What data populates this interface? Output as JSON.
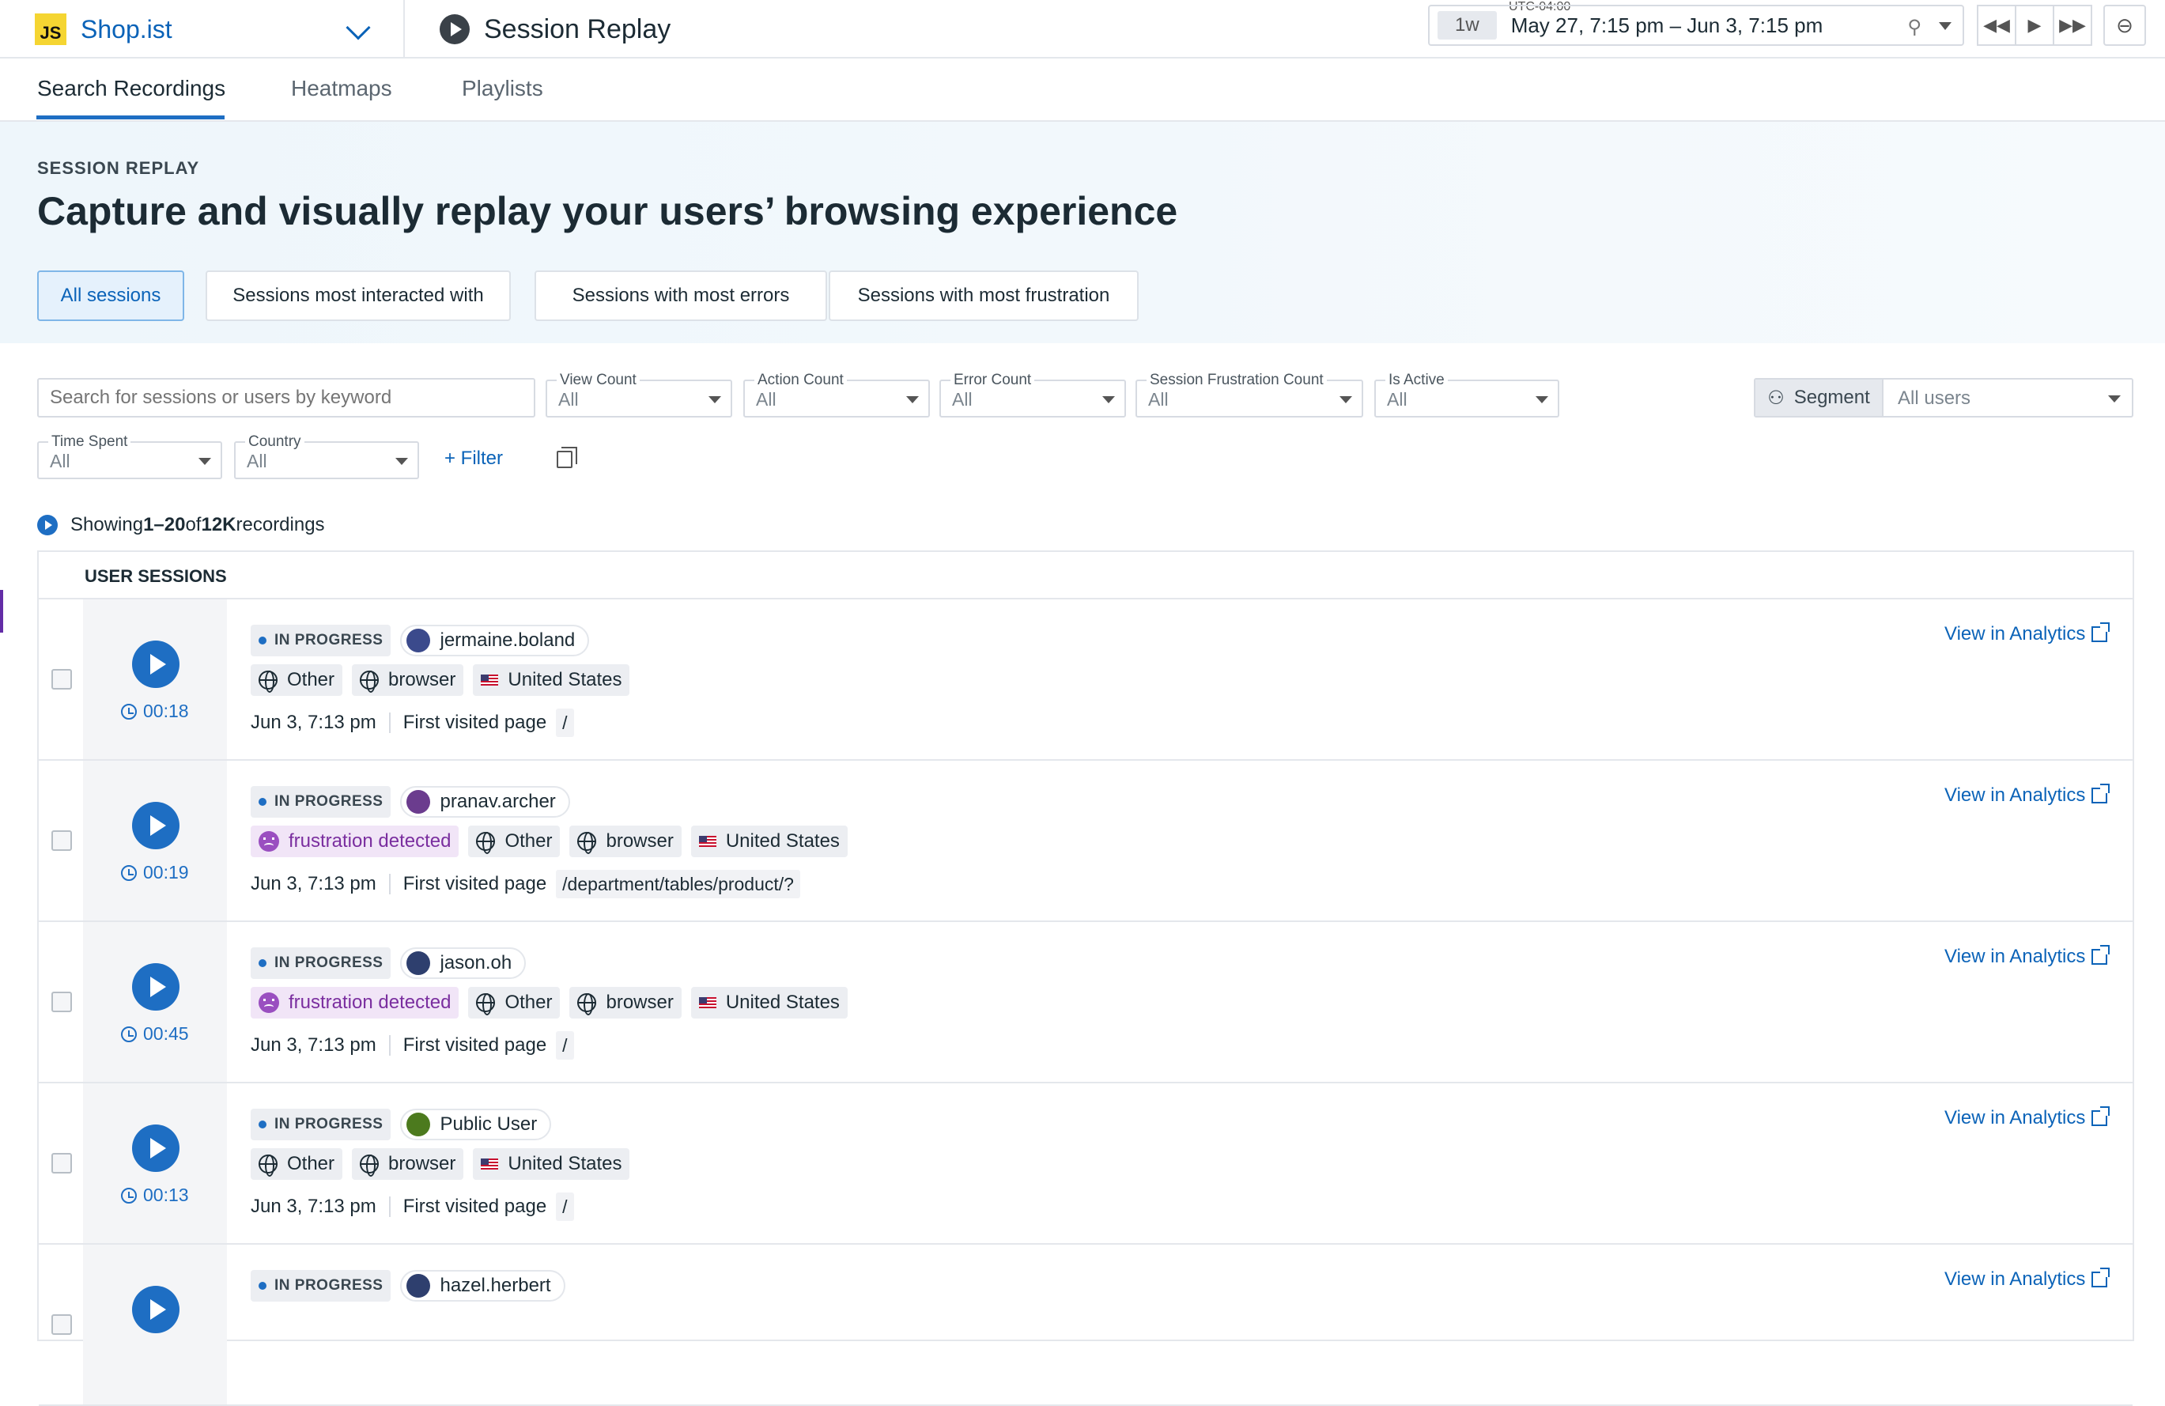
{
  "app": {
    "name": "Shop.ist",
    "logo_text": "JS"
  },
  "page": {
    "title": "Session Replay"
  },
  "timepicker": {
    "tz": "UTC-04:00",
    "badge": "1w",
    "range": "May 27, 7:15 pm – Jun 3, 7:15 pm"
  },
  "tabs": [
    "Search Recordings",
    "Heatmaps",
    "Playlists"
  ],
  "hero": {
    "kicker": "SESSION REPLAY",
    "title": "Capture and visually replay your users’ browsing experience"
  },
  "chips": [
    "All sessions",
    "Sessions most interacted with",
    "Sessions with most errors",
    "Sessions with most frustration"
  ],
  "search": {
    "placeholder": "Search for sessions or users by keyword"
  },
  "filters": [
    {
      "label": "View Count",
      "value": "All"
    },
    {
      "label": "Action Count",
      "value": "All"
    },
    {
      "label": "Error Count",
      "value": "All"
    },
    {
      "label": "Session Frustration Count",
      "value": "All"
    },
    {
      "label": "Is Active",
      "value": "All"
    },
    {
      "label": "Time Spent",
      "value": "All"
    },
    {
      "label": "Country",
      "value": "All"
    }
  ],
  "segment": {
    "label": "Segment",
    "value": "All users"
  },
  "filter_btn": "+ Filter",
  "showing": {
    "prefix": "Showing ",
    "range": "1–20",
    "mid": " of ",
    "total": "12K",
    "suffix": " recordings"
  },
  "list_header": "USER SESSIONS",
  "common": {
    "status": "IN PROGRESS",
    "frustration": "frustration detected",
    "first_visited": "First visited page",
    "analytics": "View in Analytics"
  },
  "sessions": [
    {
      "duration": "00:18",
      "user": "jermaine.boland",
      "frustration": false,
      "device": "Other",
      "browser": "browser",
      "country": "United States",
      "time": "Jun 3, 7:13 pm",
      "path": "/",
      "avatar_color": "#3b4a8c"
    },
    {
      "duration": "00:19",
      "user": "pranav.archer",
      "frustration": true,
      "device": "Other",
      "browser": "browser",
      "country": "United States",
      "time": "Jun 3, 7:13 pm",
      "path": "/department/tables/product/?",
      "avatar_color": "#6b3c8e"
    },
    {
      "duration": "00:45",
      "user": "jason.oh",
      "frustration": true,
      "device": "Other",
      "browser": "browser",
      "country": "United States",
      "time": "Jun 3, 7:13 pm",
      "path": "/",
      "avatar_color": "#2e3f6e"
    },
    {
      "duration": "00:13",
      "user": "Public User",
      "frustration": false,
      "device": "Other",
      "browser": "browser",
      "country": "United States",
      "time": "Jun 3, 7:13 pm",
      "path": "/",
      "avatar_color": "#4c7a1e"
    },
    {
      "duration": "",
      "user": "hazel.herbert",
      "frustration": false,
      "device": "",
      "browser": "",
      "country": "",
      "time": "",
      "path": "",
      "avatar_color": "#2e3f6e"
    }
  ],
  "colors": {
    "accent": "#1e6ec3",
    "link": "#0b63b8",
    "frustration": "#9a4fc0"
  }
}
